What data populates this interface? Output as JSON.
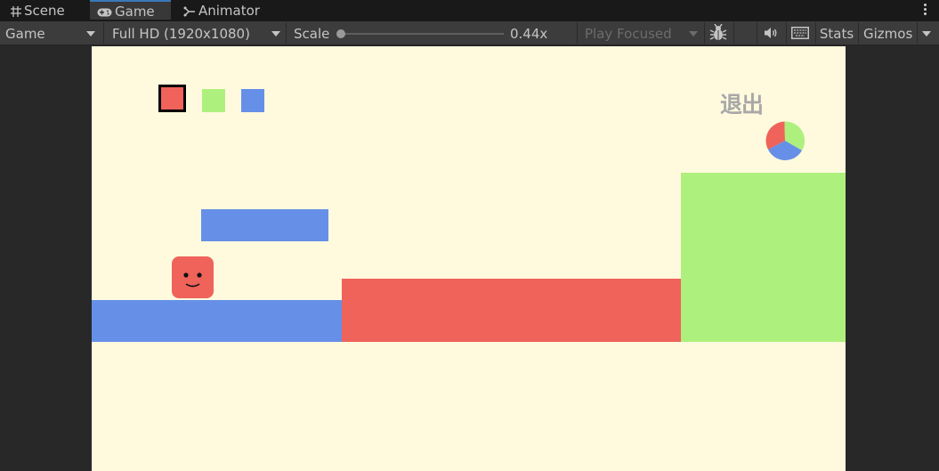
{
  "tabs": [
    {
      "label": "Scene",
      "icon": "grid-icon",
      "active": false
    },
    {
      "label": "Game",
      "icon": "gamepad-icon",
      "active": true
    },
    {
      "label": "Animator",
      "icon": "animator-icon",
      "active": false
    }
  ],
  "toolbar": {
    "display_label": "Game",
    "resolution_label": "Full HD (1920x1080)",
    "scale_label": "Scale",
    "scale_value": "0.44x",
    "scale_fraction": 0.0,
    "play_mode_label": "Play Focused",
    "stats_label": "Stats",
    "gizmos_label": "Gizmos"
  },
  "game": {
    "exit_label": "退出",
    "colors": {
      "background": "#fffadd",
      "red": "#ef635a",
      "green": "#aef07d",
      "blue": "#668fe8",
      "exit_text": "#a8a8a8"
    },
    "color_selector": [
      "red",
      "green",
      "blue"
    ],
    "selected_color": "red"
  }
}
